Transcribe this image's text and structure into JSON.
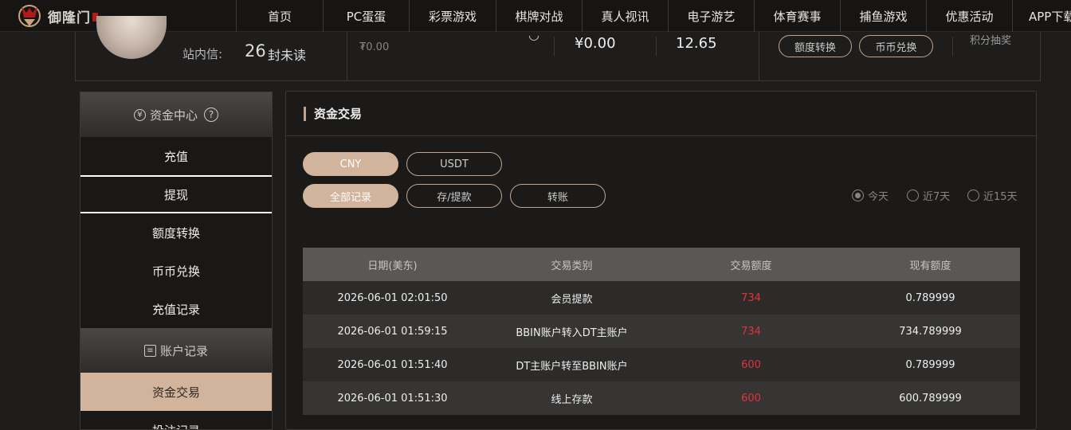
{
  "logo": {
    "text": "御隆门"
  },
  "nav": {
    "items": [
      "首页",
      "PC蛋蛋",
      "彩票游戏",
      "棋牌对战",
      "真人视讯",
      "电子游艺",
      "体育赛事",
      "捕鱼游戏",
      "优惠活动",
      "APP下载"
    ]
  },
  "account": {
    "inbox_label": "站内信:",
    "inbox_count": "26",
    "inbox_unit": "封未读",
    "small_balance": "₮0.00",
    "balance_cny": "¥0.00",
    "balance_other": "12.65",
    "quota_transfer": "额度转换",
    "currency_exchange": "币币兑换",
    "points_label": "积分抽奖"
  },
  "sidebar": {
    "fund_center": "资金中心",
    "fund_items": [
      "充值",
      "提现",
      "额度转换",
      "币币兑换",
      "充值记录"
    ],
    "account_records": "账户记录",
    "record_items": [
      "资金交易",
      "投注记录"
    ]
  },
  "main": {
    "title": "资金交易",
    "currency_tabs": [
      "CNY",
      "USDT"
    ],
    "type_tabs": [
      "全部记录",
      "存/提款",
      "转账"
    ],
    "ranges": [
      "今天",
      "近7天",
      "近15天"
    ],
    "selected_range": "今天"
  },
  "table": {
    "columns": [
      "日期(美东)",
      "交易类别",
      "交易额度",
      "现有额度"
    ],
    "rows": [
      [
        "2026-06-01 02:01:50",
        "会员提款",
        "734",
        "0.789999"
      ],
      [
        "2026-06-01 01:59:15",
        "BBIN账户转入DT主账户",
        "734",
        "734.789999"
      ],
      [
        "2026-06-01 01:51:40",
        "DT主账户转至BBIN账户",
        "600",
        "0.789999"
      ],
      [
        "2026-06-01 01:51:30",
        "线上存款",
        "600",
        "600.789999"
      ]
    ]
  },
  "colors": {
    "accent": "#d1b49b",
    "amount": "#e0343a",
    "background": "#1e1d1c"
  },
  "icons": [
    "logo-icon",
    "refresh-icon",
    "yuan-icon",
    "help-icon",
    "record-icon"
  ]
}
